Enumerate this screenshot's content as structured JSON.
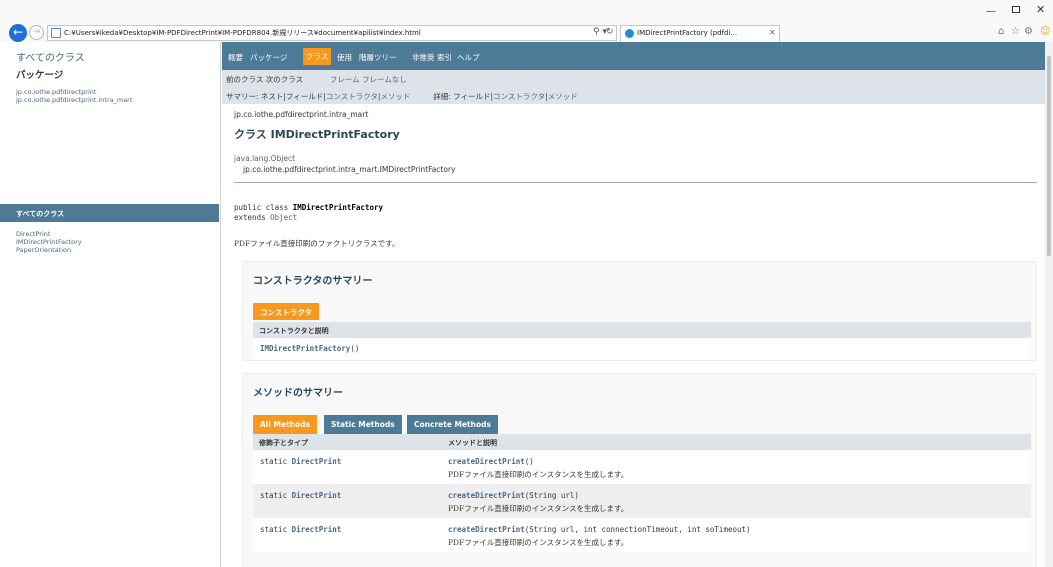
{
  "browser": {
    "url": "C:¥Users¥ikeda¥Desktop¥IM-PDFDirectPrint¥IM-PDFDR804.新規リリース¥document¥apilist¥index.html",
    "tab_title": "IMDirectPrintFactory (pdfdi...",
    "search_glyph": "⚲ ▾",
    "refresh_glyph": "↻"
  },
  "left": {
    "all_classes_link": "すべてのクラス",
    "packages_title": "パッケージ",
    "packages": [
      "jp.co.iothe.pdfdirectprint",
      "jp.co.iothe.pdfdirectprint.intra_mart"
    ],
    "classes_header": "すべてのクラス",
    "classes": [
      "DirectPrint",
      "IMDirectPrintFactory",
      "PaperOrientation"
    ]
  },
  "nav": {
    "overview": "概要",
    "package": "パッケージ",
    "class": "クラス",
    "use": "使用",
    "tree": "階層ツリー",
    "deprecated": "非推奨",
    "index": "索引",
    "help": "ヘルプ",
    "prev_class": "前のクラス",
    "next_class": "次のクラス",
    "frames": "フレーム",
    "no_frames": "フレームなし",
    "summary_label": "サマリー:",
    "summary_nested": "ネスト",
    "summary_field": "フィールド",
    "summary_constr": "コンストラクタ",
    "summary_method": "メソッド",
    "detail_label": "詳細:",
    "detail_field": "フィールド",
    "detail_constr": "コンストラクタ",
    "detail_method": "メソッド",
    "sep": "|"
  },
  "header": {
    "package": "jp.co.iothe.pdfdirectprint.intra_mart",
    "title": "クラス IMDirectPrintFactory",
    "hierarchy_root": "java.lang.Object",
    "hierarchy_class": "jp.co.iothe.pdfdirectprint.intra_mart.IMDirectPrintFactory"
  },
  "declaration": {
    "line1_prefix": "public class ",
    "class_name": "IMDirectPrintFactory",
    "extends_kw": "extends ",
    "extends_type": "Object",
    "description": "PDFファイル直接印刷のファクトリクラスです。"
  },
  "constructor_summary": {
    "title": "コンストラクタのサマリー",
    "caption": "コンストラクタ",
    "column": "コンストラクタと説明",
    "row_name": "IMDirectPrintFactory",
    "row_suffix": "()"
  },
  "method_summary": {
    "title": "メソッドのサマリー",
    "tabs": [
      "All Methods",
      "Static Methods",
      "Concrete Methods"
    ],
    "col_modifier": "修飾子とタイプ",
    "col_method": "メソッドと説明",
    "rows": [
      {
        "modifier": "static ",
        "type": "DirectPrint",
        "method": "createDirectPrint",
        "params": "()",
        "desc": "PDFファイル直接印刷のインスタンスを生成します。"
      },
      {
        "modifier": "static ",
        "type": "DirectPrint",
        "method": "createDirectPrint",
        "params": "(String url)",
        "desc": "PDFファイル直接印刷のインスタンスを生成します。"
      },
      {
        "modifier": "static ",
        "type": "DirectPrint",
        "method": "createDirectPrint",
        "params": "(String url, int connectionTimeout, int soTimeout)",
        "desc": "PDFファイル直接印刷のインスタンスを生成します。"
      }
    ]
  }
}
